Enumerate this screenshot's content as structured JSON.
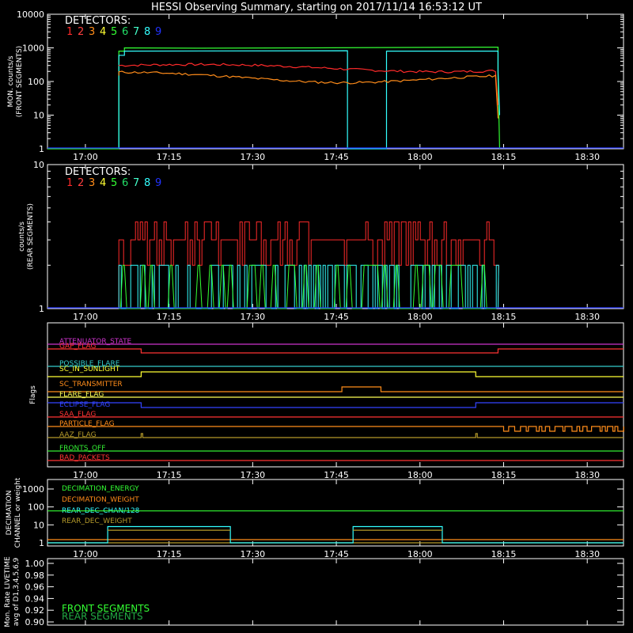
{
  "title": "HESSI Observing Summary, starting on 2017/11/14 16:53:12 UT",
  "colors": {
    "background": "#000000",
    "axis": "#ffffff",
    "det1": "#ff2a2a",
    "det2": "#ff4040",
    "det3": "#ff8c1a",
    "det4": "#ffff33",
    "det5": "#33ff33",
    "det6": "#22dd66",
    "det7": "#44ffcc",
    "det8": "#33ffff",
    "det9": "#2233ff"
  },
  "x_ticks": [
    "17:00",
    "17:15",
    "17:30",
    "17:45",
    "18:00",
    "18:15",
    "18:30"
  ],
  "detectors": {
    "label": "DETECTORS:",
    "numbers": [
      "1",
      "2",
      "3",
      "4",
      "5",
      "6",
      "7",
      "8",
      "9"
    ]
  },
  "chart_data": [
    {
      "type": "line",
      "panel": "front_rates",
      "ylabel": "MON. counts/s (FRONT SEGMENTS)",
      "ylabel_line1": "MON. counts/s",
      "ylabel_line2": "(FRONT SEGMENTS)",
      "y_scale": "log",
      "ylim": [
        1,
        10000
      ],
      "y_ticks": [
        "1",
        "10",
        "100",
        "1000",
        "10000"
      ],
      "x_range": [
        "16:53:12",
        "18:36"
      ],
      "series": [
        {
          "color": "#33ff33",
          "x": [
            "17:06",
            "17:07",
            "17:10",
            "17:30",
            "17:50",
            "18:10",
            "18:14"
          ],
          "values": [
            800,
            1050,
            1000,
            1000,
            1050,
            1050,
            1050
          ]
        },
        {
          "color": "#33ffff",
          "x": [
            "17:06",
            "17:07",
            "17:47",
            "17:48",
            "17:54",
            "17:55",
            "18:14"
          ],
          "values": [
            600,
            800,
            800,
            1,
            1,
            800,
            800
          ]
        },
        {
          "color": "#ff2a2a",
          "x": [
            "17:06",
            "17:10",
            "17:30",
            "17:45",
            "18:00",
            "18:14"
          ],
          "values": [
            300,
            280,
            240,
            230,
            250,
            200
          ]
        },
        {
          "color": "#ff8c1a",
          "x": [
            "17:06",
            "17:10",
            "17:25",
            "17:35",
            "17:45",
            "18:00",
            "18:14"
          ],
          "values": [
            150,
            170,
            120,
            70,
            100,
            110,
            75
          ]
        },
        {
          "color": "#2233ff",
          "x": [
            "16:53",
            "18:36"
          ],
          "values": [
            1,
            1
          ]
        }
      ]
    },
    {
      "type": "line",
      "panel": "rear_rates",
      "ylabel": "counts/s (REAR SEGMENTS)",
      "ylabel_line1": "counts/s",
      "ylabel_line2": "(REAR SEGMENTS)",
      "y_scale": "log",
      "ylim": [
        1,
        10
      ],
      "y_ticks": [
        "1",
        "10"
      ],
      "series": [
        {
          "color": "#ff2a2a",
          "x": [
            "17:06",
            "18:14"
          ],
          "values": [
            3,
            3
          ],
          "note": "noisy 2-4 counts/s"
        },
        {
          "color": "#33ffff",
          "x": [
            "17:06",
            "18:14"
          ],
          "values": [
            2,
            2
          ],
          "note": "noisy 1-2 counts/s"
        },
        {
          "color": "#2233ff",
          "x": [
            "16:53",
            "18:36"
          ],
          "values": [
            1,
            1
          ]
        }
      ]
    },
    {
      "type": "line",
      "panel": "flags",
      "ylabel": "Flags",
      "flags": [
        {
          "name": "ATTENUATOR_STATE",
          "color": "#cc33cc"
        },
        {
          "name": "GAP_FLAG",
          "color": "#ff3333"
        },
        {
          "name": "POSSIBLE_FLARE",
          "color": "#33cccc"
        },
        {
          "name": "SC_IN_SUNLIGHT",
          "color": "#ffff33"
        },
        {
          "name": "SC_TRANSMITTER",
          "color": "#ff8c1a"
        },
        {
          "name": "FLARE_FLAG",
          "color": "#ffff55"
        },
        {
          "name": "ECLIPSE_FLAG",
          "color": "#3344ff"
        },
        {
          "name": "SAA_FLAG",
          "color": "#ff3333"
        },
        {
          "name": "PARTICLE_FLAG",
          "color": "#ff8c1a"
        },
        {
          "name": "AAZ_FLAG",
          "color": "#b59a2a"
        },
        {
          "name": "FRONTS_OFF",
          "color": "#33ee33"
        },
        {
          "name": "BAD_PACKETS",
          "color": "#ff3333"
        }
      ]
    },
    {
      "type": "line",
      "panel": "decimation",
      "ylabel": "DECIMATION CHANNEL or weight",
      "ylabel_line1": "DECIMATION",
      "ylabel_line2": "CHANNEL or weight",
      "y_scale": "log",
      "y_ticks": [
        "1",
        "10",
        "100",
        "1000"
      ],
      "series": [
        {
          "name": "DECIMATION_ENERGY",
          "color": "#33ff33",
          "values": [
            60
          ]
        },
        {
          "name": "DECIMATION_WEIGHT",
          "color": "#ff8c1a",
          "values": [
            1.5
          ]
        },
        {
          "name": "REAR_DEC_CHAN/128",
          "color": "#33ffff",
          "x": [
            "17:04",
            "17:25",
            "17:48",
            "18:04"
          ],
          "values": [
            8,
            8,
            8,
            8
          ]
        },
        {
          "name": "REAR_DEC_WEIGHT",
          "color": "#b59a2a",
          "values": [
            1
          ]
        }
      ]
    },
    {
      "type": "line",
      "panel": "livetime",
      "ylabel": "Mon. Rate LIVETIME avg of D1,3,4,5,6,9",
      "ylabel_line1": "Mon. Rate LIVETIME",
      "ylabel_line2": "avg of D1,3,4,5,6,9",
      "ylim": [
        0.9,
        1.0
      ],
      "y_ticks": [
        "0.90",
        "0.92",
        "0.94",
        "0.96",
        "0.98",
        "1.00"
      ],
      "series": [
        {
          "name": "FRONT SEGMENTS",
          "color": "#33ff33"
        },
        {
          "name": "REAR SEGMENTS",
          "color": "#22aa44"
        }
      ]
    }
  ]
}
